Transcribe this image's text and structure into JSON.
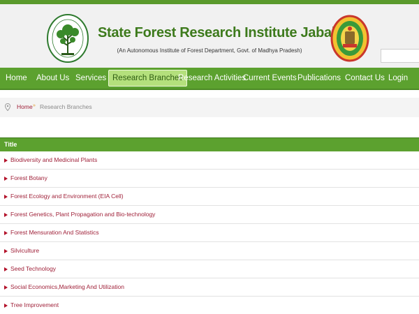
{
  "header": {
    "title": "State Forest Research Institute Jabalpur",
    "subtitle": "(An Autonomous Institute of Forest Department, Govt. of Madhya Pradesh)",
    "search_value": ""
  },
  "nav": {
    "items": [
      {
        "label": "Home"
      },
      {
        "label": "About Us"
      },
      {
        "label": "Services"
      },
      {
        "label": "Research Branches"
      },
      {
        "label": "Research Activities"
      },
      {
        "label": "Current Events"
      },
      {
        "label": "Publications"
      },
      {
        "label": "Contact Us"
      },
      {
        "label": "Login"
      }
    ]
  },
  "breadcrumb": {
    "home": "Home",
    "separator": "»",
    "current": "Research Branches"
  },
  "table": {
    "header": "Title",
    "rows": [
      {
        "title": "Biodiversity and Medicinal Plants"
      },
      {
        "title": "Forest Botany"
      },
      {
        "title": "Forest Ecology and Environment (EIA Cell)"
      },
      {
        "title": "Forest Genetics, Plant Propagation and Bio-technology"
      },
      {
        "title": "Forest Mensuration And Statistics"
      },
      {
        "title": "Silviculture"
      },
      {
        "title": "Seed Technology"
      },
      {
        "title": "Social Economics,Marketing And Utilization"
      },
      {
        "title": "Tree Improvement"
      }
    ]
  },
  "colors": {
    "brand_green": "#5ca12f",
    "title_green": "#3d7a1c",
    "link_red": "#a0223a",
    "active_tab": "#b4e07c"
  }
}
